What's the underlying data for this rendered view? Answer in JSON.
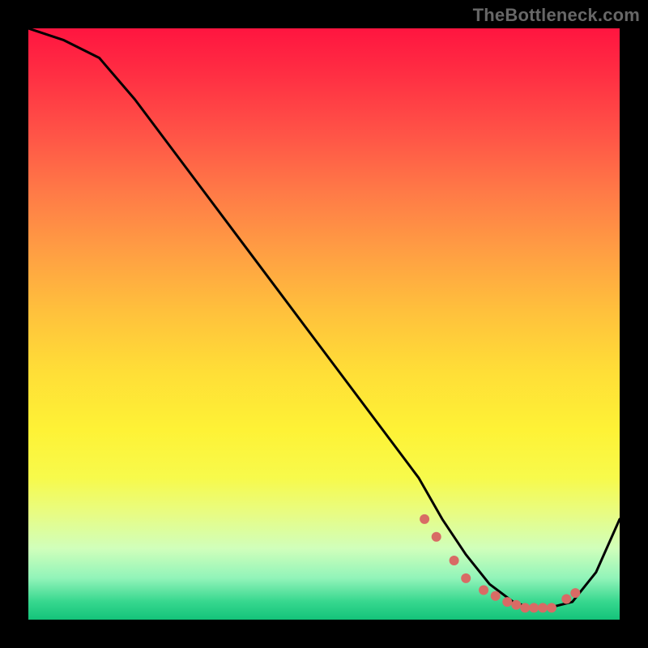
{
  "watermark": "TheBottleneck.com",
  "chart_data": {
    "type": "line",
    "title": "",
    "xlabel": "",
    "ylabel": "",
    "xlim": [
      0,
      100
    ],
    "ylim": [
      0,
      100
    ],
    "series": [
      {
        "name": "curve",
        "color": "#000000",
        "x": [
          0,
          6,
          12,
          18,
          24,
          30,
          36,
          42,
          48,
          54,
          60,
          66,
          70,
          74,
          78,
          82,
          85,
          88,
          92,
          96,
          100
        ],
        "values": [
          100,
          98,
          95,
          88,
          80,
          72,
          64,
          56,
          48,
          40,
          32,
          24,
          17,
          11,
          6,
          3,
          2,
          2,
          3,
          8,
          17
        ]
      }
    ],
    "markers": {
      "name": "highlight-dots",
      "color": "#d86b65",
      "radius": 6,
      "x": [
        67,
        69,
        72,
        74,
        77,
        79,
        81,
        82.5,
        84,
        85.5,
        87,
        88.5,
        91,
        92.5
      ],
      "values": [
        17,
        14,
        10,
        7,
        5,
        4,
        3,
        2.5,
        2,
        2,
        2,
        2,
        3.5,
        4.5
      ]
    },
    "background_gradient": {
      "direction": "vertical",
      "stops": [
        {
          "pos": 0.0,
          "color": "#ff1540"
        },
        {
          "pos": 0.5,
          "color": "#ffc13c"
        },
        {
          "pos": 0.8,
          "color": "#f7fa4b"
        },
        {
          "pos": 1.0,
          "color": "#14c37a"
        }
      ]
    },
    "grid": false,
    "legend": null
  }
}
